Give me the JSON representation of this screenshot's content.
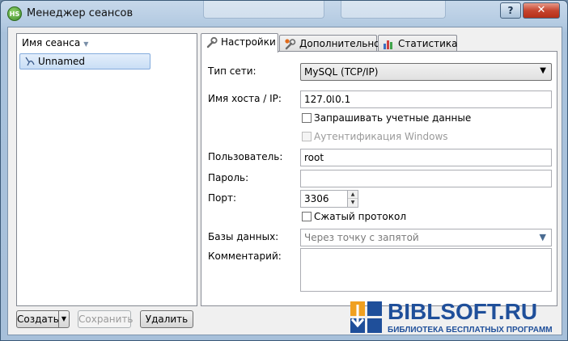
{
  "window": {
    "title": "Менеджер сеансов",
    "help_label": "?",
    "close_label": "✕",
    "app_icon_text": "HS"
  },
  "sessions": {
    "column_header": "Имя сеанса",
    "items": [
      {
        "label": "Unnamed",
        "icon": "connection-plug-icon"
      }
    ]
  },
  "buttons": {
    "create": "Создать",
    "save": "Сохранить",
    "delete": "Удалить"
  },
  "tabs": [
    {
      "label": "Настройки",
      "icon": "wrench-icon",
      "active": true
    },
    {
      "label": "Дополнительно",
      "icon": "wrench-star-icon",
      "active": false
    },
    {
      "label": "Статистика",
      "icon": "bar-chart-icon",
      "active": false
    }
  ],
  "settings": {
    "network_type": {
      "label": "Тип сети:",
      "value": "MySQL (TCP/IP)"
    },
    "host": {
      "label": "Имя хоста / IP:",
      "value": "127.0.0.1"
    },
    "prompt_credentials": {
      "label": "Запрашивать учетные данные",
      "checked": false
    },
    "windows_auth": {
      "label": "Аутентификация Windows",
      "checked": false,
      "disabled": true
    },
    "user": {
      "label": "Пользователь:",
      "value": "root"
    },
    "password": {
      "label": "Пароль:",
      "value": ""
    },
    "port": {
      "label": "Порт:",
      "value": "3306"
    },
    "compressed": {
      "label": "Сжатый протокол",
      "checked": false
    },
    "databases": {
      "label": "Базы данных:",
      "placeholder": "Через точку с запятой"
    },
    "comment": {
      "label": "Комментарий:",
      "value": ""
    }
  },
  "watermark": {
    "title": "BIBLSOFT.RU",
    "subtitle": "БИБЛИОТЕКА БЕСПЛАТНЫХ ПРОГРАММ"
  },
  "colors": {
    "title_bar": "#b4cbe2",
    "close_button": "#c6452f",
    "selection": "#c9def5",
    "watermark": "#1f4f9a"
  }
}
